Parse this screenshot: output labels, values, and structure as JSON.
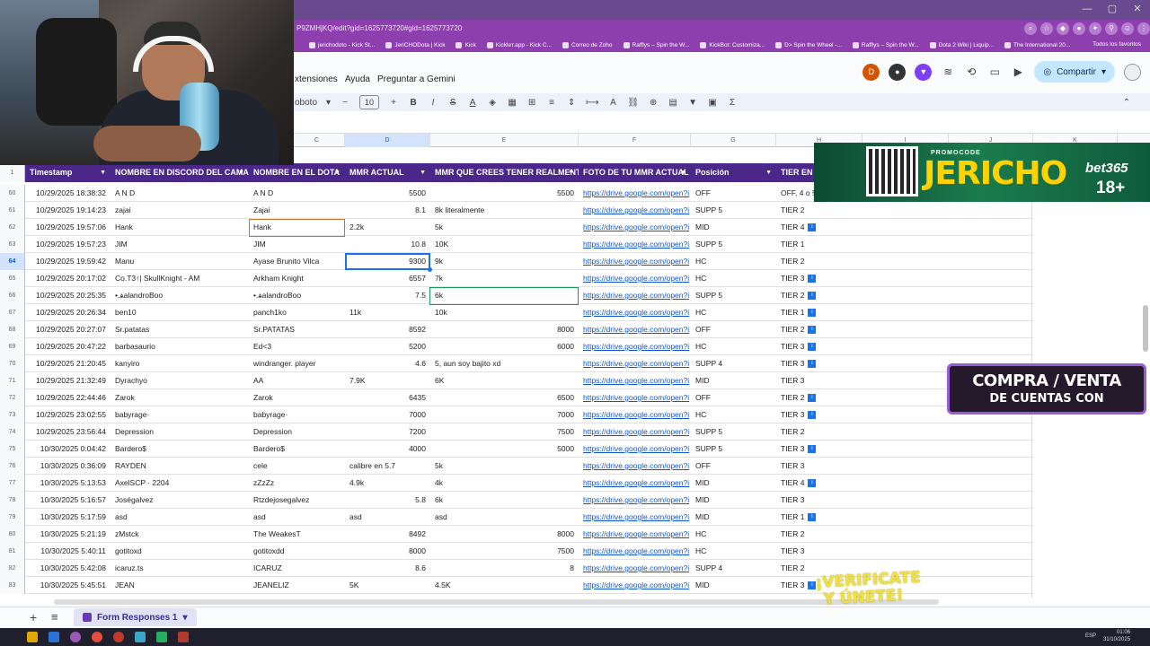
{
  "browser": {
    "url": "P9ZMHjKQ/edit?gid=1625773720#gid=1625773720",
    "bookmarks": [
      "jerichodoto - Kick St...",
      "JeriCHODota | Kick",
      "Kick",
      "Kickleт.app - Kick C...",
      "Correo de Zoho",
      "Rafflys – Spin the W...",
      "KickBot: Customiza...",
      "D> Spin the Wheel -...",
      "Rafflys – Spin the W...",
      "Dota 2 Wiki | Liquip...",
      "The International 20..."
    ],
    "bookmarks_right": "Todos los favoritos"
  },
  "sheets": {
    "menu": [
      "xtensiones",
      "Ayuda",
      "Preguntar a Gemini"
    ],
    "avatar_letter": "D",
    "share_label": "Compartir",
    "font_name": "oboto",
    "font_size": "10",
    "toolbar_sigma": "Σ",
    "col_letters": [
      "C",
      "D",
      "E",
      "F",
      "G",
      "H",
      "I",
      "J",
      "K"
    ],
    "sheet_tab": "Form Responses 1",
    "headers": [
      "Timestamp",
      "NOMBRE EN DISCORD DEL CAMAL",
      "NOMBRE EN EL DOTA",
      "MMR ACTUAL",
      "MMR QUE CREES TENER REALMENTE",
      "FOTO DE TU MMR ACTUAL",
      "Posición",
      "TIER EN E"
    ],
    "header_row_num": "1",
    "rows": [
      {
        "n": "60",
        "ts": "10/29/2025 18:38:32",
        "discord": "A N D",
        "dota": "A N D",
        "mmr": "5500",
        "mmr_r": "right",
        "real": "5500",
        "real_r": "right",
        "foto": "https://drive.google.com/open?i",
        "pos": "OFF",
        "tier": "OFF, 4 o 5",
        "badge": ""
      },
      {
        "n": "61",
        "ts": "10/29/2025 19:14:23",
        "discord": "zajai",
        "dota": "Zajai",
        "mmr": "8.1",
        "mmr_r": "right",
        "real": "8k literalmente",
        "real_r": "left",
        "foto": "https://drive.google.com/open?i",
        "pos": "SUPP 5",
        "tier": "TIER 2",
        "badge": ""
      },
      {
        "n": "62",
        "ts": "10/29/2025 19:57:06",
        "discord": "Hank",
        "dota": "Hank",
        "mmr": "2.2k",
        "mmr_r": "left",
        "real": "5k",
        "real_r": "left",
        "foto": "https://drive.google.com/open?i",
        "pos": "MID",
        "tier": "TIER 4",
        "badge": "i"
      },
      {
        "n": "63",
        "ts": "10/29/2025 19:57:23",
        "discord": "JIM",
        "dota": "JIM",
        "mmr": "10.8",
        "mmr_r": "right",
        "real": "10K",
        "real_r": "left",
        "foto": "https://drive.google.com/open?i",
        "pos": "SUPP 5",
        "tier": "TIER 1",
        "badge": ""
      },
      {
        "n": "64",
        "ts": "10/29/2025 19:59:42",
        "discord": "Manu",
        "dota": "Ayase Brunito Vilca",
        "mmr": "9300",
        "mmr_r": "right",
        "real": "9k",
        "real_r": "left",
        "foto": "https://drive.google.com/open?i",
        "pos": "HC",
        "tier": "TIER 2",
        "badge": ""
      },
      {
        "n": "65",
        "ts": "10/29/2025 20:17:02",
        "discord": "Co.T3↑| SkullKnight - AM",
        "dota": "Arkham Knight",
        "mmr": "6557",
        "mmr_r": "right",
        "real": "7k",
        "real_r": "left",
        "foto": "https://drive.google.com/open?i",
        "pos": "HC",
        "tier": "TIER 3",
        "badge": "i"
      },
      {
        "n": "66",
        "ts": "10/29/2025 20:25:35",
        "discord": "•.ѧalandroBoo",
        "dota": "•.ѧalandroBoo",
        "mmr": "7.5",
        "mmr_r": "right",
        "real": "6k",
        "real_r": "left",
        "foto": "https://drive.google.com/open?i",
        "pos": "SUPP 5",
        "tier": "TIER 2",
        "badge": "i"
      },
      {
        "n": "67",
        "ts": "10/29/2025 20:26:34",
        "discord": "ben10",
        "dota": "panch1ko",
        "mmr": "11k",
        "mmr_r": "left",
        "real": "10k",
        "real_r": "left",
        "foto": "https://drive.google.com/open?i",
        "pos": "HC",
        "tier": "TIER 1",
        "badge": "i"
      },
      {
        "n": "68",
        "ts": "10/29/2025 20:27:07",
        "discord": "Sr.patatas",
        "dota": "Sr.PATATAS",
        "mmr": "8592",
        "mmr_r": "right",
        "real": "8000",
        "real_r": "right",
        "foto": "https://drive.google.com/open?i",
        "pos": "OFF",
        "tier": "TIER 2",
        "badge": "i"
      },
      {
        "n": "69",
        "ts": "10/29/2025 20:47:22",
        "discord": "barbasaurio",
        "dota": "Ed<3",
        "mmr": "5200",
        "mmr_r": "right",
        "real": "6000",
        "real_r": "right",
        "foto": "https://drive.google.com/open?i",
        "pos": "HC",
        "tier": "TIER 3",
        "badge": "i"
      },
      {
        "n": "70",
        "ts": "10/29/2025 21:20:45",
        "discord": "kanyiro",
        "dota": "windranger. player",
        "mmr": "4.6",
        "mmr_r": "right",
        "real": "5, aun soy bajito xd",
        "real_r": "left",
        "foto": "https://drive.google.com/open?i",
        "pos": "SUPP 4",
        "tier": "TIER 3",
        "badge": "i"
      },
      {
        "n": "71",
        "ts": "10/29/2025 21:32:49",
        "discord": "Dyrachyo",
        "dota": "AA",
        "mmr": "7.9K",
        "mmr_r": "left",
        "real": "6K",
        "real_r": "left",
        "foto": "https://drive.google.com/open?i",
        "pos": "MID",
        "tier": "TIER 3",
        "badge": ""
      },
      {
        "n": "72",
        "ts": "10/29/2025 22:44:46",
        "discord": "Zarok",
        "dota": "Zarok",
        "mmr": "6435",
        "mmr_r": "right",
        "real": "6500",
        "real_r": "right",
        "foto": "https://drive.google.com/open?i",
        "pos": "OFF",
        "tier": "TIER 2",
        "badge": "i"
      },
      {
        "n": "73",
        "ts": "10/29/2025 23:02:55",
        "discord": "babyrage·",
        "dota": "babyrage·",
        "mmr": "7000",
        "mmr_r": "right",
        "real": "7000",
        "real_r": "right",
        "foto": "https://drive.google.com/open?i",
        "pos": "HC",
        "tier": "TIER 3",
        "badge": "i"
      },
      {
        "n": "74",
        "ts": "10/29/2025 23:56:44",
        "discord": "Depression",
        "dota": "Depression",
        "mmr": "7200",
        "mmr_r": "right",
        "real": "7500",
        "real_r": "right",
        "foto": "https://drive.google.com/open?i",
        "pos": "SUPP 5",
        "tier": "TIER 2",
        "badge": ""
      },
      {
        "n": "75",
        "ts": "10/30/2025 0:04:42",
        "discord": "Bardero$",
        "dota": "Bardero$",
        "mmr": "4000",
        "mmr_r": "right",
        "real": "5000",
        "real_r": "right",
        "foto": "https://drive.google.com/open?i",
        "pos": "SUPP 5",
        "tier": "TIER 3",
        "badge": "i"
      },
      {
        "n": "76",
        "ts": "10/30/2025 0:36:09",
        "discord": "RAYDEN",
        "dota": "cele",
        "mmr": "calibre en 5.7",
        "mmr_r": "left",
        "real": "5k",
        "real_r": "left",
        "foto": "https://drive.google.com/open?i",
        "pos": "OFF",
        "tier": "TIER 3",
        "badge": ""
      },
      {
        "n": "77",
        "ts": "10/30/2025 5:13:53",
        "discord": "AxelSCP · 2204",
        "dota": "zZzZz",
        "mmr": "4.9k",
        "mmr_r": "left",
        "real": "4k",
        "real_r": "left",
        "foto": "https://drive.google.com/open?i",
        "pos": "MID",
        "tier": "TIER 4",
        "badge": "i"
      },
      {
        "n": "78",
        "ts": "10/30/2025 5:16:57",
        "discord": "Joségalvez",
        "dota": "Rtzdejosegalvez",
        "mmr": "5.8",
        "mmr_r": "right",
        "real": "6k",
        "real_r": "left",
        "foto": "https://drive.google.com/open?i",
        "pos": "MID",
        "tier": "TIER 3",
        "badge": ""
      },
      {
        "n": "79",
        "ts": "10/30/2025 5:17:59",
        "discord": "asd",
        "dota": "asd",
        "mmr": "asd",
        "mmr_r": "left",
        "real": "asd",
        "real_r": "left",
        "foto": "https://drive.google.com/open?i",
        "pos": "MID",
        "tier": "TIER 1",
        "badge": "i"
      },
      {
        "n": "80",
        "ts": "10/30/2025 5:21:19",
        "discord": "zMstck",
        "dota": "The WeakesT",
        "mmr": "8492",
        "mmr_r": "right",
        "real": "8000",
        "real_r": "right",
        "foto": "https://drive.google.com/open?i",
        "pos": "HC",
        "tier": "TIER 2",
        "badge": ""
      },
      {
        "n": "81",
        "ts": "10/30/2025 5:40:11",
        "discord": "gotitoxd",
        "dota": "gotitoxdd",
        "mmr": "8000",
        "mmr_r": "right",
        "real": "7500",
        "real_r": "right",
        "foto": "https://drive.google.com/open?i",
        "pos": "HC",
        "tier": "TIER 3",
        "badge": ""
      },
      {
        "n": "82",
        "ts": "10/30/2025 5:42:08",
        "discord": "icaruz.ts",
        "dota": "ICARUZ",
        "mmr": "8.6",
        "mmr_r": "right",
        "real": "8",
        "real_r": "right",
        "foto": "https://drive.google.com/open?i",
        "pos": "SUPP 4",
        "tier": "TIER 2",
        "badge": ""
      },
      {
        "n": "83",
        "ts": "10/30/2025 5:45:51",
        "discord": "JEAN",
        "dota": "JEANELIZ",
        "mmr": "5K",
        "mmr_r": "left",
        "real": "4.5K",
        "real_r": "left",
        "foto": "https://drive.google.com/open?i",
        "pos": "MID",
        "tier": "TIER 3",
        "badge": "i"
      }
    ]
  },
  "overlays": {
    "promo_label": "PROMOCODE",
    "promo_code": "JERICHO",
    "brand": "bet365",
    "age": "18+",
    "compra_line1": "COMPRA / VENTA",
    "compra_line2": "DE CUENTAS CON",
    "verificate_line1": "¡VERIFICATE",
    "verificate_line2": "Y ÚNETE!"
  },
  "taskbar": {
    "lang": "ESP",
    "time": "01:06",
    "date": "31/10/2025"
  },
  "colors": {
    "header_purple": "#4a2788",
    "browser_purple": "#8e3fae",
    "link_blue": "#1155cc",
    "ad_green": "#1b7b4c",
    "promo_yellow": "#ffd200"
  }
}
